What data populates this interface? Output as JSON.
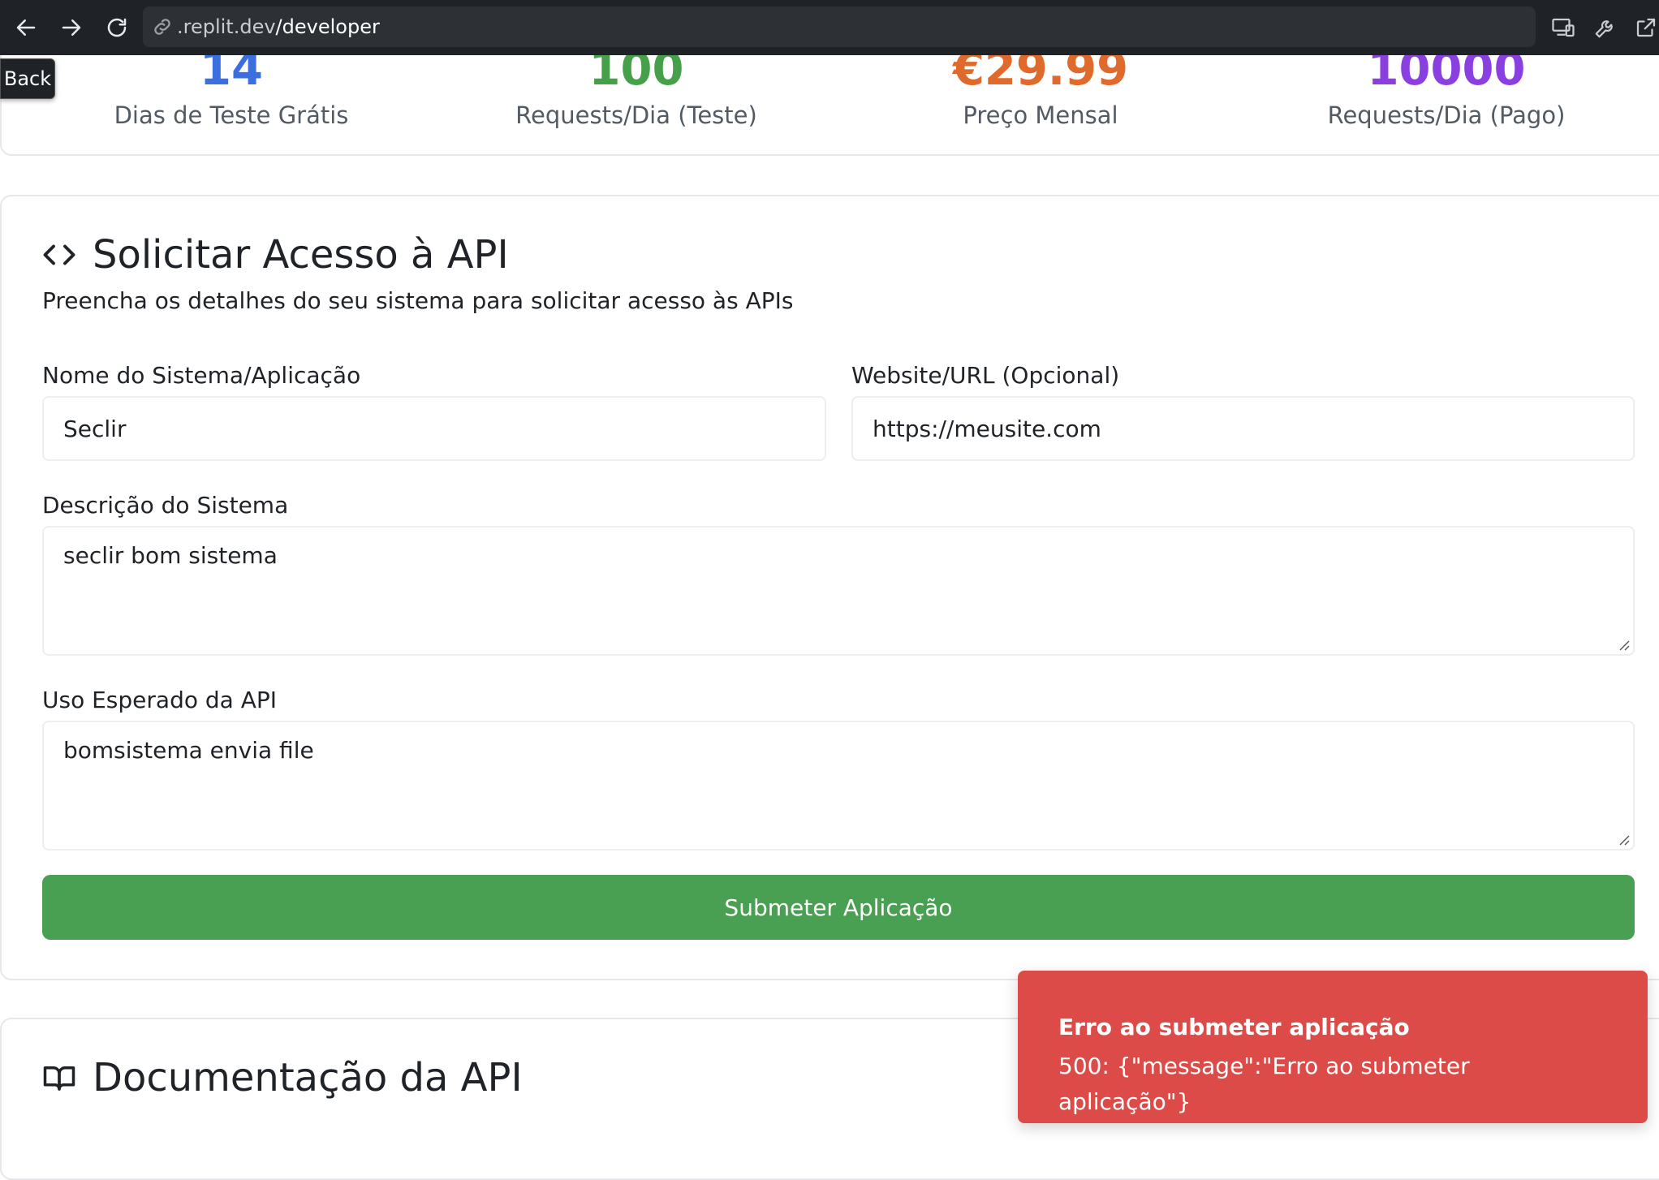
{
  "browser": {
    "url_host": ".replit.dev",
    "url_path": "/developer",
    "back_tooltip": "Back"
  },
  "stats": [
    {
      "value": "14",
      "label": "Dias de Teste Grátis",
      "color": "#3b6fe0"
    },
    {
      "value": "100",
      "label": "Requests/Dia (Teste)",
      "color": "#45a049"
    },
    {
      "value": "€29.99",
      "label": "Preço Mensal",
      "color": "#e06a2b"
    },
    {
      "value": "10000",
      "label": "Requests/Dia (Pago)",
      "color": "#8a3fe0"
    }
  ],
  "form": {
    "title": "Solicitar Acesso à API",
    "description": "Preencha os detalhes do seu sistema para solicitar acesso às APIs",
    "name_label": "Nome do Sistema/Aplicação",
    "name_value": "Seclir",
    "website_label": "Website/URL (Opcional)",
    "website_value": "https://meusite.com",
    "desc_label": "Descrição do Sistema",
    "desc_value": "seclir bom sistema",
    "usage_label": "Uso Esperado da API",
    "usage_value": "bomsistema envia file",
    "submit_label": "Submeter Aplicação"
  },
  "docs": {
    "title": "Documentação da API"
  },
  "toast": {
    "title": "Erro ao submeter aplicação",
    "message": "500: {\"message\":\"Erro ao submeter aplicação\"}"
  },
  "colors": {
    "submit": "#4aa052",
    "toast": "#dc4b47",
    "browser_bar": "#1f2328"
  },
  "icons": {
    "back": "arrow-left-icon",
    "forward": "arrow-right-icon",
    "reload": "reload-icon",
    "link": "link-icon",
    "devices": "devices-icon",
    "wrench": "wrench-icon",
    "external": "external-link-icon",
    "code": "code-icon",
    "book": "book-icon"
  }
}
